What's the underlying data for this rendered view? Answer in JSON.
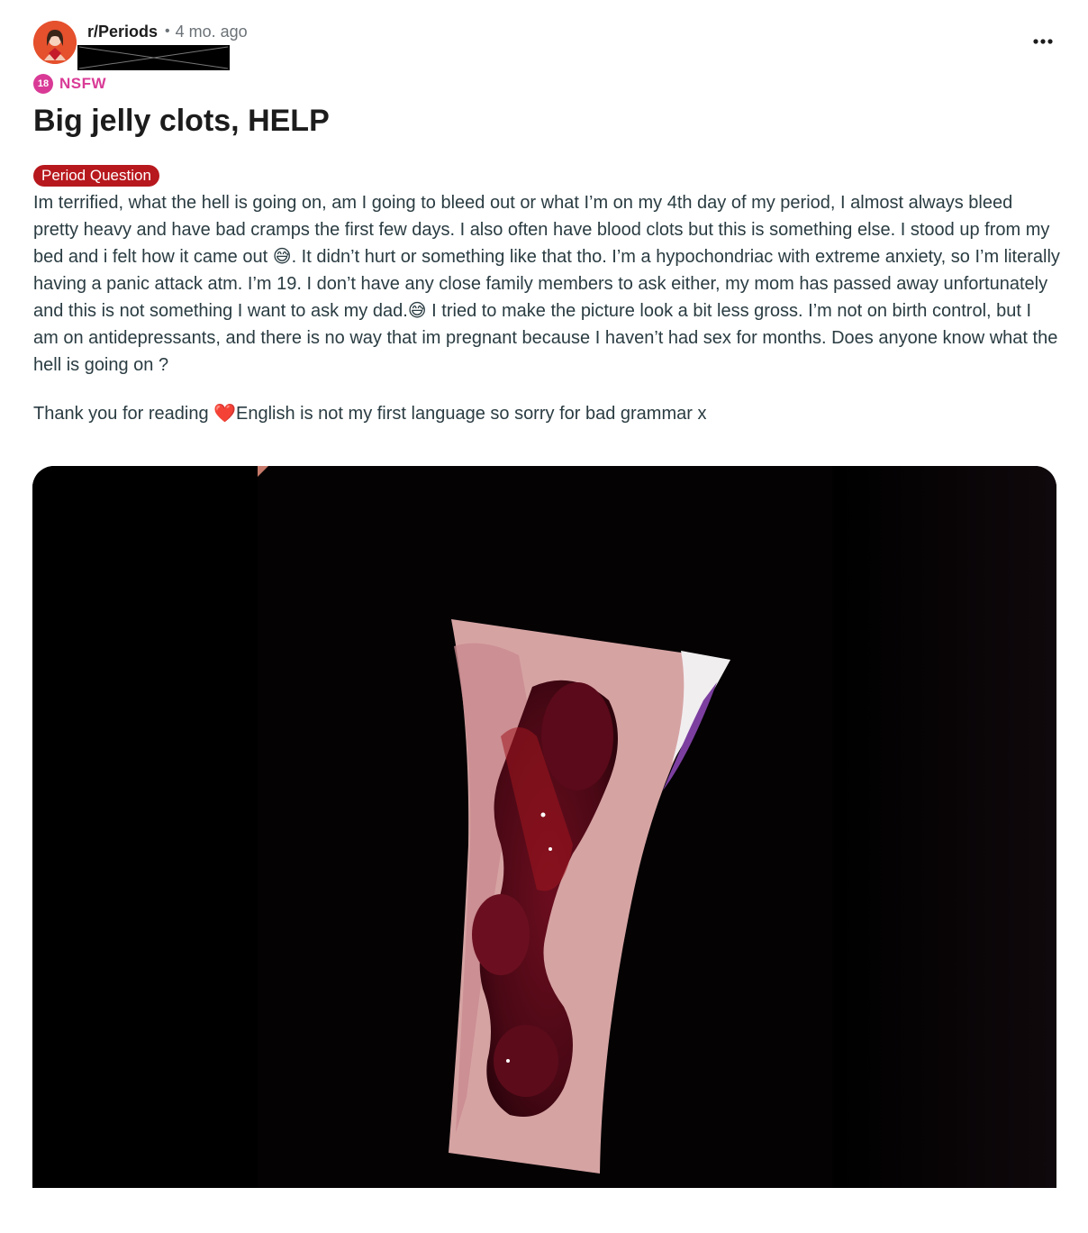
{
  "post": {
    "subreddit": "r/Periods",
    "separator": "•",
    "age": "4 mo. ago",
    "nsfw_badge": "18",
    "nsfw_label": "NSFW",
    "title": "Big jelly clots, HELP",
    "flair": "Period Question",
    "body_paragraphs": [
      "Im terrified, what the hell is going on, am I going to bleed out or what I’m on my 4th day of my period, I almost always bleed pretty heavy and have bad cramps the first few days. I also often have blood clots but this is something else. I stood up from my bed and i felt how it came out 😅. It didn’t hurt or something like that tho. I’m a hypochondriac with extreme anxiety, so I’m literally having a panic attack atm. I’m 19. I don’t have any close family members to ask either, my mom has passed away unfortunately and this is not something I want to ask my dad.😅 I tried to make the picture look a bit less gross. I’m not on birth control, but I am on antidepressants, and there is no way that im pregnant because I haven’t had sex for months. Does anyone know what the hell is going on ?",
      "Thank you for reading ❤️English is not my first language so sorry for bad grammar x"
    ]
  },
  "icons": {
    "avatar": "subreddit-avatar-icon",
    "more": "more-options-icon",
    "nsfw": "nsfw-18-icon"
  },
  "colors": {
    "nsfw": "#d93a96",
    "flair_bg": "#b7181d",
    "avatar_bg": "#e5502d",
    "body_text": "#2a3c42",
    "meta_text": "#6b7277"
  }
}
